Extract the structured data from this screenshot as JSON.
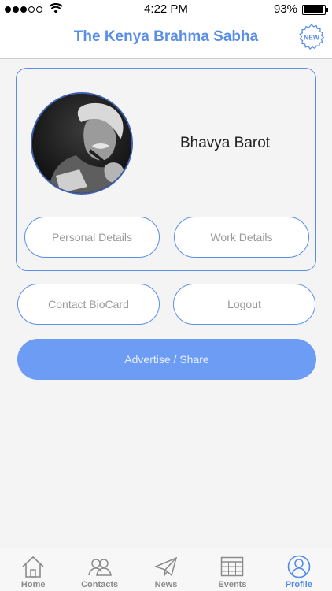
{
  "status_bar": {
    "time": "4:22 PM",
    "battery": "93%",
    "battery_level": 0.93,
    "signal_bars_filled": 3,
    "signal_bars_total": 5
  },
  "header": {
    "title": "The Kenya Brahma Sabha",
    "badge_label": "NEW"
  },
  "profile": {
    "name": "Bhavya Barot",
    "avatar_icon": "profile-photo"
  },
  "buttons": {
    "personal_details": "Personal Details",
    "work_details": "Work Details",
    "contact_biocard": "Contact BioCard",
    "logout": "Logout",
    "advertise_share": "Advertise / Share"
  },
  "tabs": [
    {
      "label": "Home",
      "icon": "home-icon",
      "active": false
    },
    {
      "label": "Contacts",
      "icon": "contacts-icon",
      "active": false
    },
    {
      "label": "News",
      "icon": "paper-plane-icon",
      "active": false
    },
    {
      "label": "Events",
      "icon": "calendar-grid-icon",
      "active": false
    },
    {
      "label": "Profile",
      "icon": "profile-icon",
      "active": true
    }
  ],
  "colors": {
    "accent": "#5b8fe6",
    "advertise_button": "#6d9cf4",
    "active_tab": "#4f89e8",
    "inactive_tab": "#8a8a8a",
    "background": "#f4f4f4"
  }
}
